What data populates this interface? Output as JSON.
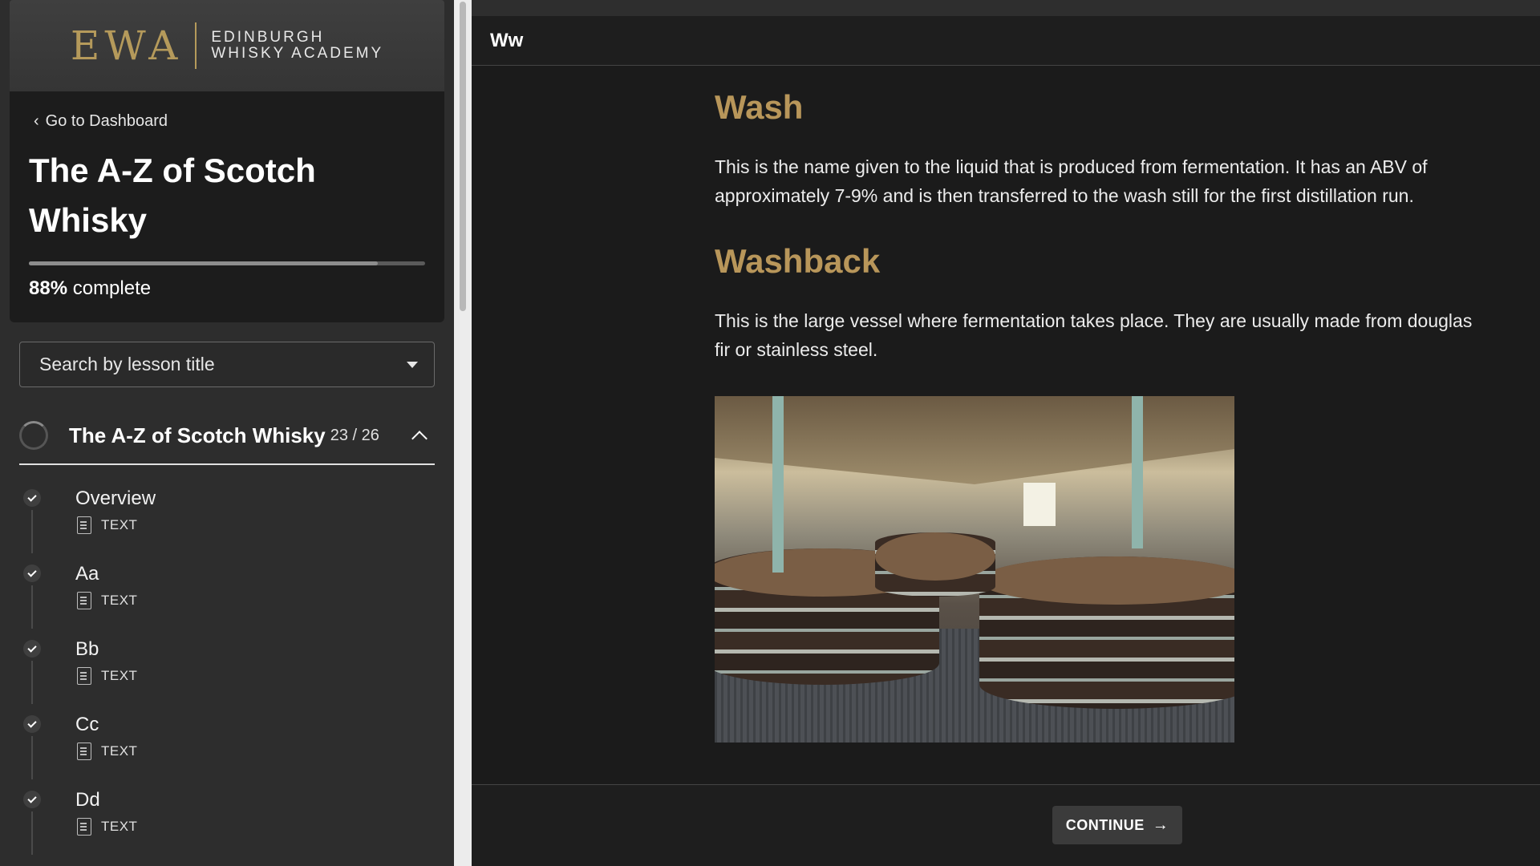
{
  "brand": {
    "logo_mark": "EWA",
    "name_line1": "EDINBURGH",
    "name_line2": "WHISKY ACADEMY"
  },
  "course": {
    "back_link": "Go to Dashboard",
    "title": "The A-Z of Scotch Whisky",
    "progress_percent": "88%",
    "progress_suffix": "complete",
    "progress_fraction": 0.88
  },
  "search": {
    "placeholder": "Search by lesson title"
  },
  "section": {
    "title": "The A-Z of Scotch Whisky",
    "count": "23 / 26"
  },
  "lessons": [
    {
      "name": "Overview",
      "type": "TEXT",
      "completed": true
    },
    {
      "name": "Aa",
      "type": "TEXT",
      "completed": true
    },
    {
      "name": "Bb",
      "type": "TEXT",
      "completed": true
    },
    {
      "name": "Cc",
      "type": "TEXT",
      "completed": true
    },
    {
      "name": "Dd",
      "type": "TEXT",
      "completed": true
    }
  ],
  "lesson_header": {
    "title": "Ww"
  },
  "entries": [
    {
      "term": "Wash",
      "definition": "This is the name given to the liquid that is produced from fermentation. It has an ABV of approximately 7-9% and is then transferred to the wash still for the first distillation run."
    },
    {
      "term": "Washback",
      "definition": "This is the large vessel where fermentation takes place. They are usually made from douglas fir or stainless steel."
    }
  ],
  "footer": {
    "continue_label": "CONTINUE"
  },
  "colors": {
    "accent_gold": "#b8965a",
    "sidebar_bg": "#2d2d2d",
    "main_bg": "#1b1b1b"
  }
}
